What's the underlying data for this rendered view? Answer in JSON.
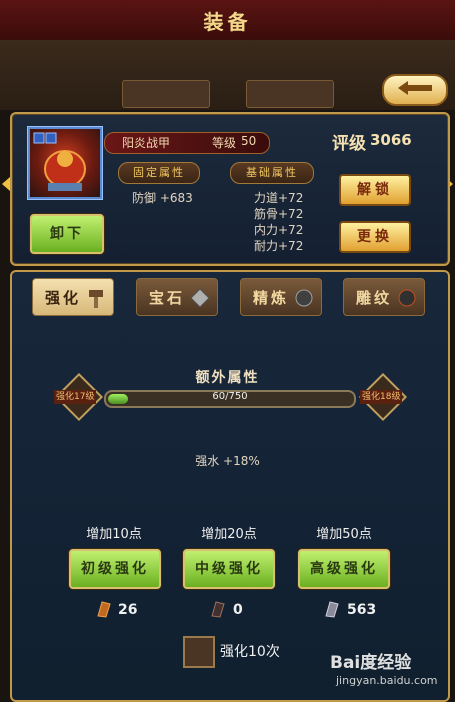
{
  "header": {
    "title": "装备"
  },
  "item": {
    "name": "阳炎战甲",
    "level_label": "等级",
    "level": "50",
    "score_label": "评级",
    "score": "3066",
    "fixed_attr_label": "固定属性",
    "fixed_attr": "防御 +683",
    "base_attr_label": "基础属性",
    "base_attrs": [
      "力道+72",
      "筋骨+72",
      "内力+72",
      "耐力+72"
    ],
    "unload_label": "卸下",
    "unlock_label": "解锁",
    "replace_label": "更换"
  },
  "tabs": [
    {
      "label": "强化",
      "active": true
    },
    {
      "label": "宝石",
      "active": false
    },
    {
      "label": "精炼",
      "active": false
    },
    {
      "label": "雕纹",
      "active": false
    }
  ],
  "enhance": {
    "bonus_title": "额外属性",
    "left_level": "强化17级",
    "right_level": "强化18级",
    "progress_text": "60/750",
    "progress_fraction": 0.08,
    "bonus_line": "强水 +18%",
    "options": [
      {
        "add_label": "增加10点",
        "button": "初级强化",
        "cost": "26"
      },
      {
        "add_label": "增加20点",
        "button": "中级强化",
        "cost": "0"
      },
      {
        "add_label": "增加50点",
        "button": "高级强化",
        "cost": "563"
      }
    ],
    "multi_label": "强化10次"
  },
  "watermark": {
    "brand": "Bai度经验",
    "url": "jingyan.baidu.com"
  },
  "colors": {
    "gold": "#c09a4a",
    "panel": "#142032",
    "green": "#6ab020",
    "accent_red": "#6a1616"
  }
}
